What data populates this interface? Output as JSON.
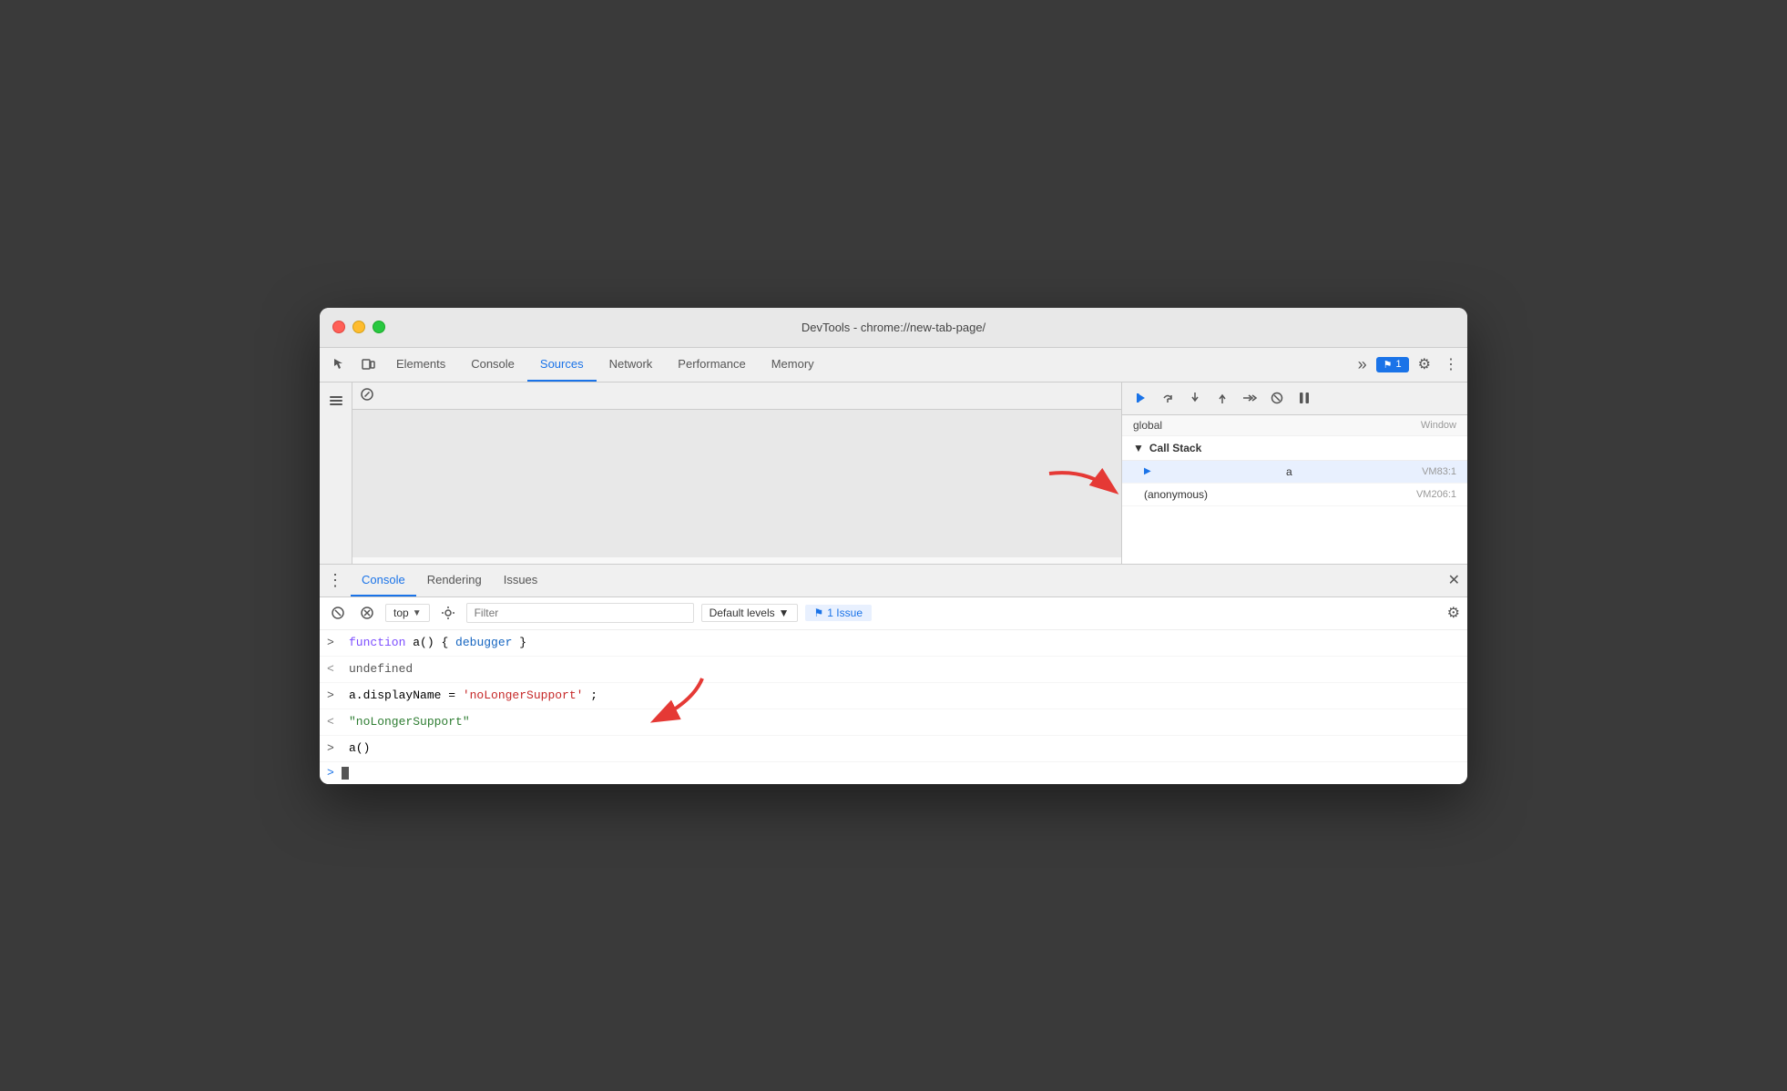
{
  "window": {
    "title": "DevTools - chrome://new-tab-page/"
  },
  "tabs": {
    "items": [
      {
        "label": "Elements",
        "active": false
      },
      {
        "label": "Console",
        "active": false
      },
      {
        "label": "Sources",
        "active": true
      },
      {
        "label": "Network",
        "active": false
      },
      {
        "label": "Performance",
        "active": false
      },
      {
        "label": "Memory",
        "active": false
      }
    ],
    "more": "»",
    "badge": "⚑ 1",
    "gear": "⚙",
    "menu": "⋮"
  },
  "sources": {
    "sidebar_icon": "▶"
  },
  "debugger": {
    "buttons": [
      "▶",
      "↺",
      "↓",
      "↑",
      "→→",
      "✎",
      "⏸"
    ],
    "scope": {
      "label": "global",
      "value": "Window"
    },
    "callstack": {
      "header": "Call Stack",
      "items": [
        {
          "name": "a",
          "location": "VM83:1",
          "active": true
        },
        {
          "name": "(anonymous)",
          "location": "VM206:1",
          "active": false
        }
      ]
    }
  },
  "console": {
    "tabs": [
      {
        "label": "Console",
        "active": true
      },
      {
        "label": "Rendering",
        "active": false
      },
      {
        "label": "Issues",
        "active": false
      }
    ],
    "toolbar": {
      "filter_placeholder": "Filter",
      "levels_label": "Default levels",
      "issue_label": "⚑ 1 Issue"
    },
    "lines": [
      {
        "prompt": ">",
        "type": "input",
        "parts": [
          {
            "text": "function",
            "style": "purple"
          },
          {
            "text": " a() { ",
            "style": "normal"
          },
          {
            "text": "debugger",
            "style": "blue"
          },
          {
            "text": " }",
            "style": "normal"
          }
        ]
      },
      {
        "prompt": "<",
        "type": "output",
        "parts": [
          {
            "text": "undefined",
            "style": "undefined"
          }
        ]
      },
      {
        "prompt": ">",
        "type": "input",
        "parts": [
          {
            "text": "a.displayName = ",
            "style": "normal"
          },
          {
            "text": "'noLongerSupport'",
            "style": "red"
          },
          {
            "text": ";",
            "style": "normal"
          }
        ]
      },
      {
        "prompt": "<",
        "type": "output",
        "parts": [
          {
            "text": "\"noLongerSupport\"",
            "style": "green"
          }
        ]
      },
      {
        "prompt": ">",
        "type": "input",
        "parts": [
          {
            "text": "a()",
            "style": "normal"
          }
        ]
      }
    ],
    "cursor_prompt": ">"
  }
}
